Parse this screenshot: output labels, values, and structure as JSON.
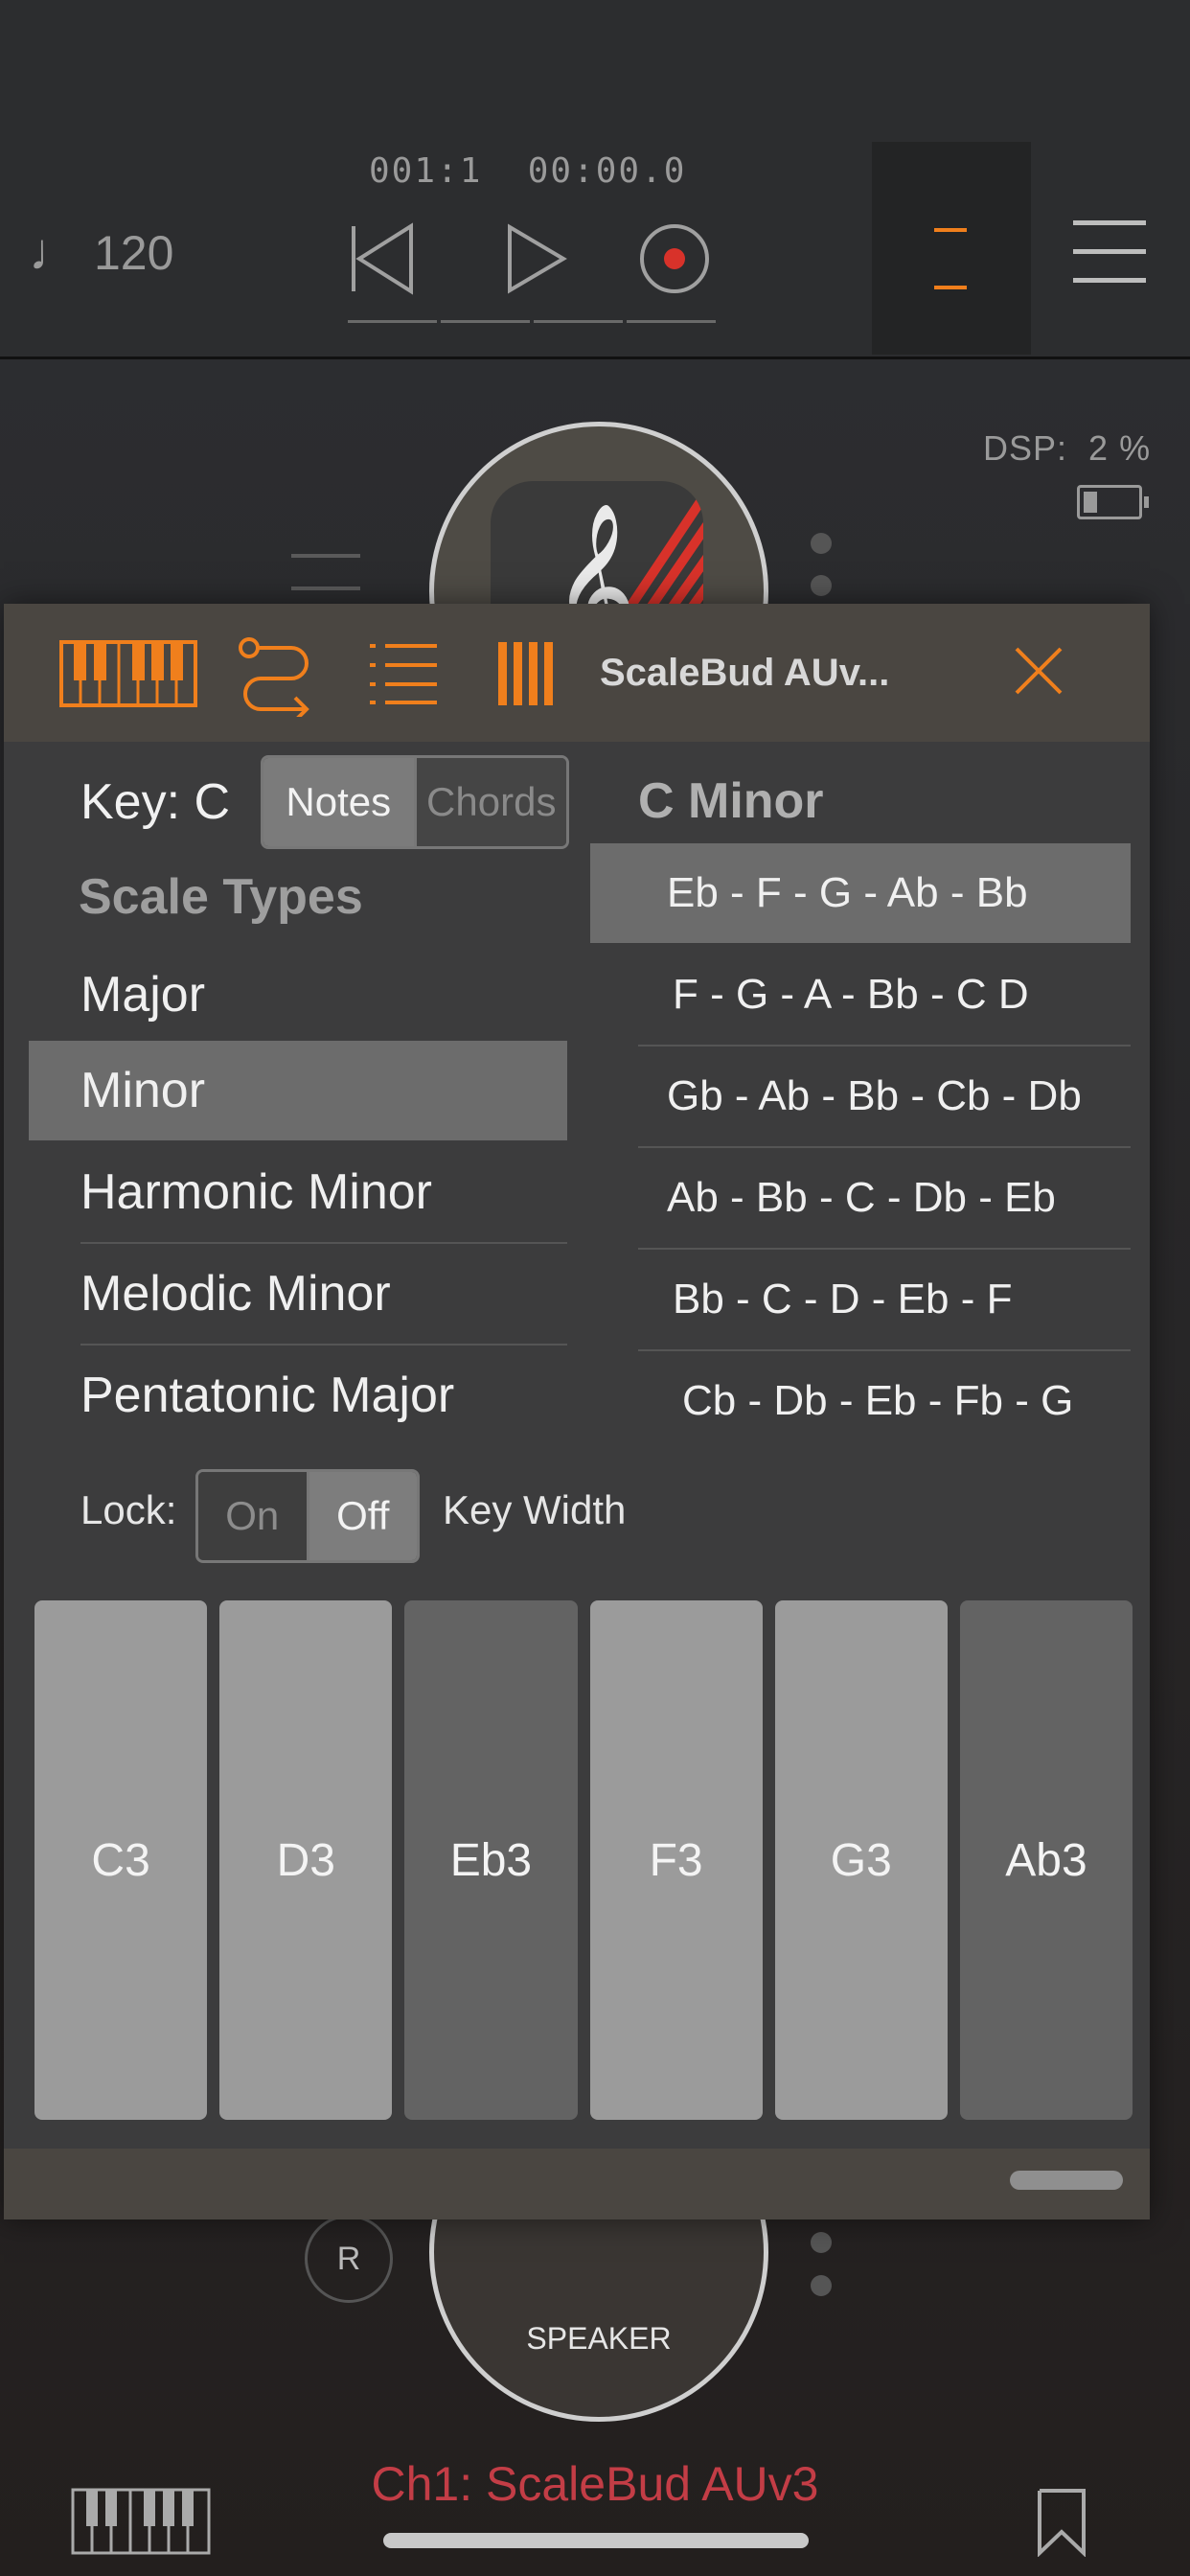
{
  "transport": {
    "tempo": "120",
    "position": "001:1",
    "time": "00:00.0"
  },
  "status": {
    "dsp_label": "DSP:",
    "dsp_value": "2 %"
  },
  "plugin": {
    "title": "ScaleBud AUv...",
    "key_label": "Key: C",
    "mode_toggle": [
      "Notes",
      "Chords"
    ],
    "mode_selected": "Notes",
    "scale_title": "C Minor",
    "scale_types_header": "Scale Types",
    "scale_types": [
      "Major",
      "Minor",
      "Harmonic Minor",
      "Melodic Minor",
      "Pentatonic Major"
    ],
    "scale_selected": "Minor",
    "modes": [
      "Eb - F - G - Ab - Bb",
      "F - G - A - Bb - C    D",
      "Gb - Ab - Bb - Cb - Db",
      "Ab - Bb - C - Db - Eb",
      "Bb - C - D - Eb - F",
      "Cb - Db - Eb - Fb - G"
    ],
    "lock_label": "Lock:",
    "lock_options": [
      "On",
      "Off"
    ],
    "lock_selected": "Off",
    "key_width_label": "Key Width",
    "keys": [
      "C3",
      "D3",
      "Eb3",
      "F3",
      "G3",
      "Ab3"
    ]
  },
  "host": {
    "record_label": "R",
    "speaker_label": "SPEAKER",
    "channel_label": "Ch1: ScaleBud AUv3"
  },
  "colors": {
    "accent": "#f07f1c",
    "record": "#d8322a",
    "channel": "#c33d46"
  }
}
